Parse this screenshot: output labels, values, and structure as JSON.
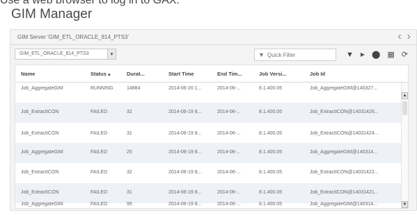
{
  "caption": "Use a web browser to log in to GAX.",
  "app": {
    "title": "GIM Manager"
  },
  "server_bar": {
    "title": "GIM Server 'GIM_ETL_ORACLE_814_PTS3'",
    "prev_icon": "chevron-left-icon",
    "next_icon": "chevron-right-icon"
  },
  "toolbar": {
    "selector_value": "GIM_ETL_ORACLE_814_PTS3",
    "quick_filter_placeholder": "Quick Filter",
    "icons": [
      "filter-icon",
      "play-icon",
      "stop-icon",
      "column-chooser-icon",
      "refresh-icon"
    ]
  },
  "table": {
    "columns": [
      {
        "label": "Name"
      },
      {
        "label": "Status ▴"
      },
      {
        "label": "Durat..."
      },
      {
        "label": "Start Time"
      },
      {
        "label": "End Tim..."
      },
      {
        "label": "Job Versi..."
      },
      {
        "label": "Job Id"
      }
    ],
    "rows": [
      [
        "Job_AggregateGIM",
        "RUNNING",
        "14884",
        "2014-06-20 1...",
        "2014-06-...",
        "8.1.400.05",
        "Job_AggregateGIM@140327..."
      ],
      [
        "Job_ExtractICON",
        "FAILED",
        "32",
        "2014-06-19 8...",
        "2014-06-...",
        "8.1.400.05",
        "Job_ExtractICON@14031426..."
      ],
      [
        "Job_ExtractICON",
        "FAILED",
        "31",
        "2014-06-19 8...",
        "2014-06-...",
        "8.1.400.05",
        "Job_ExtractICON@14031424..."
      ],
      [
        "Job_AggregateGIM",
        "FAILED",
        "25",
        "2014-06-19 8...",
        "2014-06-...",
        "8.1.400.05",
        "Job_AggregateGIM@140314..."
      ],
      [
        "Job_ExtractICON",
        "FAILED",
        "32",
        "2014-06-19 8...",
        "2014-06-...",
        "8.1.400.05",
        "Job_ExtractICON@14031422..."
      ],
      [
        "Job_ExtractICON",
        "FAILED",
        "31",
        "2014-06-19 8...",
        "2014-06-...",
        "8.1.400.05",
        "Job_ExtractICON@14031421..."
      ],
      [
        "Job_AggregateGIM",
        "FAILED",
        "95",
        "2014-06-19 8...",
        "2014-06-...",
        "8.1.400.05",
        "Job_AggregateGIM@140314..."
      ]
    ]
  }
}
